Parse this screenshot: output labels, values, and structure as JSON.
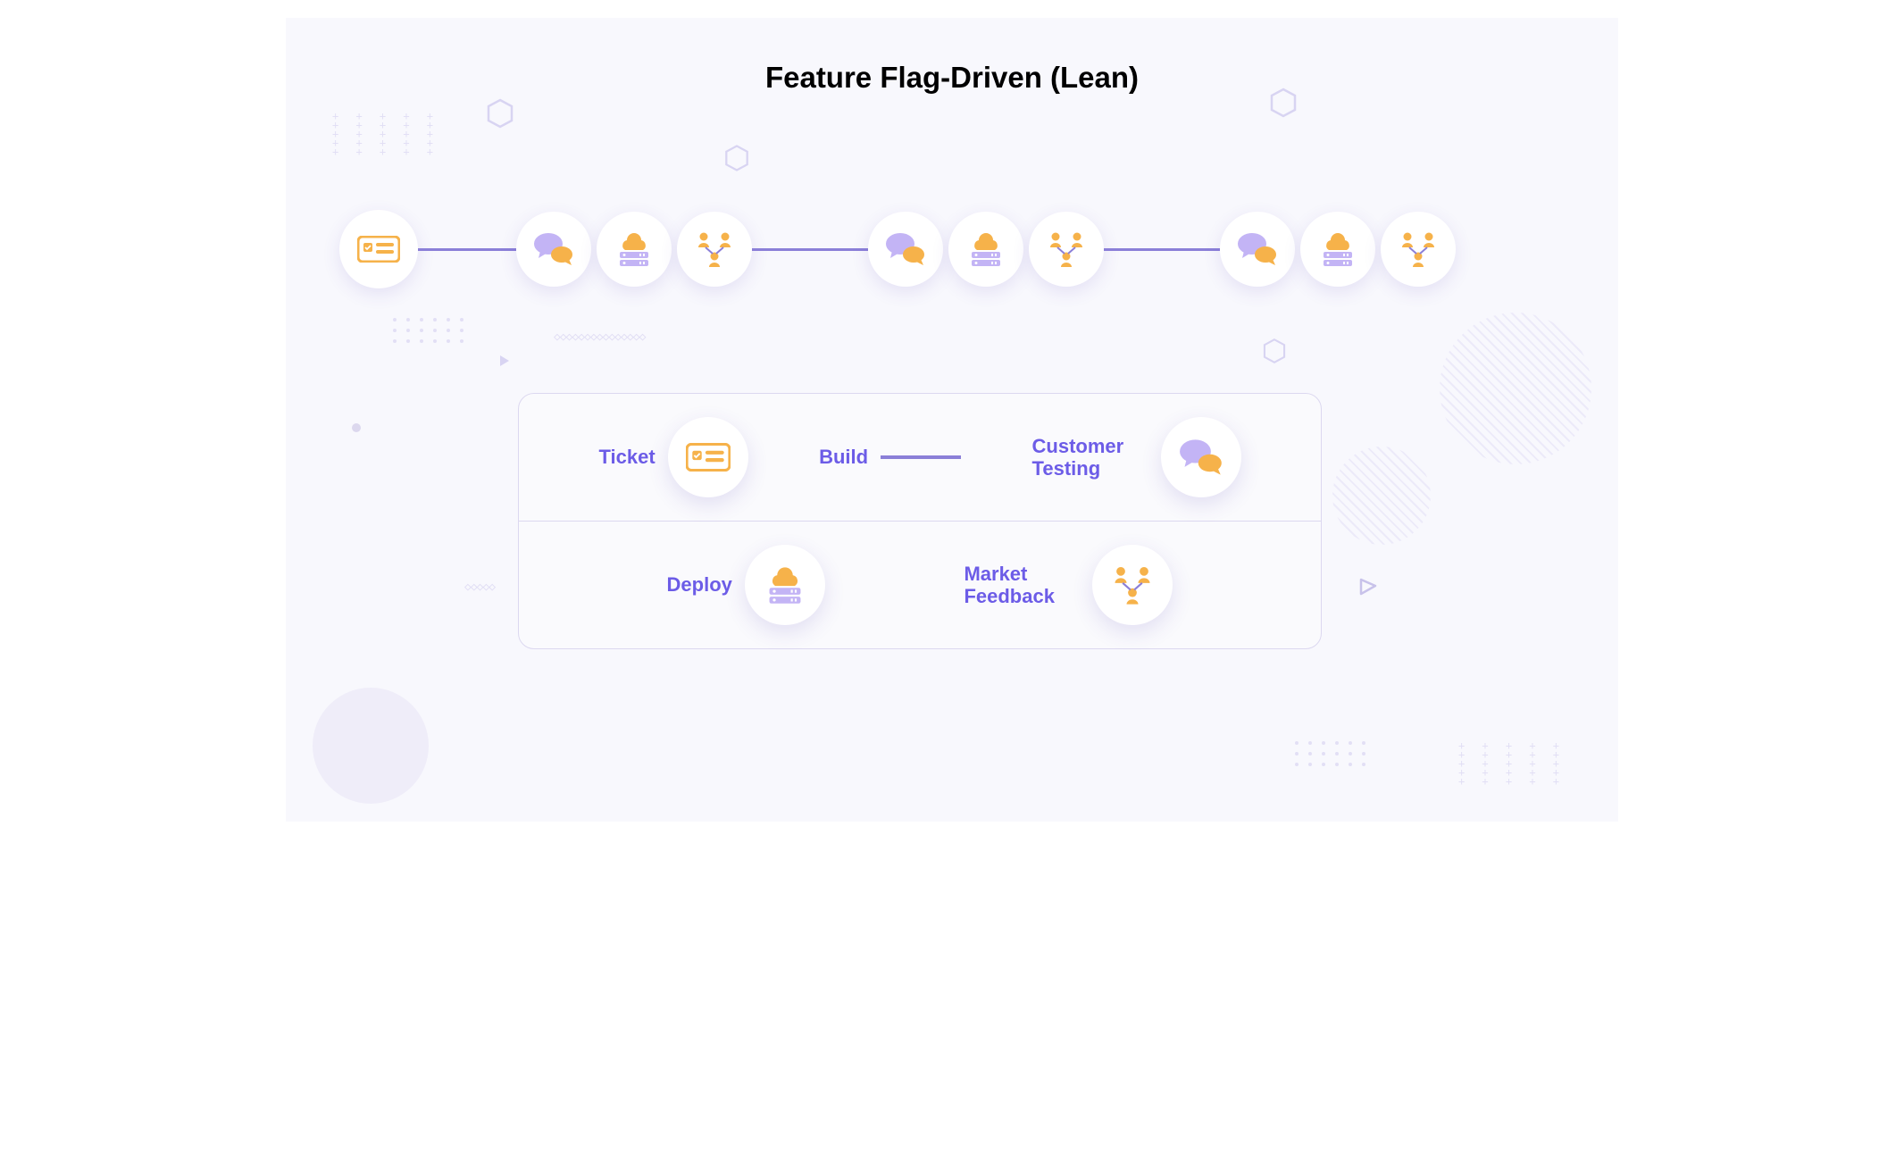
{
  "title": "Feature Flag-Driven (Lean)",
  "flow": {
    "start_icon": "ticket",
    "iteration_icons": [
      "chat",
      "deploy",
      "feedback"
    ],
    "iterations": 3
  },
  "legend": {
    "row1": [
      {
        "label": "Ticket",
        "icon": "ticket"
      },
      {
        "label": "Build",
        "icon": "line"
      },
      {
        "label": "Customer Testing",
        "icon": "chat"
      }
    ],
    "row2": [
      {
        "label": "Deploy",
        "icon": "deploy"
      },
      {
        "label": "Market Feedback",
        "icon": "feedback"
      }
    ]
  },
  "colors": {
    "orange": "#f6b24a",
    "purple": "#c3b4f5",
    "line": "#8b7fd8",
    "label": "#6c5ce7"
  }
}
